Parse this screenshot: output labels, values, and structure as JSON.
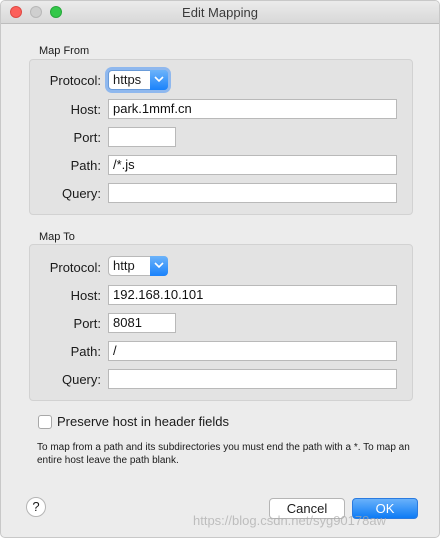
{
  "window": {
    "title": "Edit Mapping"
  },
  "map_from": {
    "section_label": "Map From",
    "protocol_label": "Protocol:",
    "protocol_value": "https",
    "host_label": "Host:",
    "host_value": "park.1mmf.cn",
    "port_label": "Port:",
    "port_value": "",
    "path_label": "Path:",
    "path_value": "/*.js",
    "query_label": "Query:",
    "query_value": ""
  },
  "map_to": {
    "section_label": "Map To",
    "protocol_label": "Protocol:",
    "protocol_value": "http",
    "host_label": "Host:",
    "host_value": "192.168.10.101",
    "port_label": "Port:",
    "port_value": "8081",
    "path_label": "Path:",
    "path_value": "/",
    "query_label": "Query:",
    "query_value": ""
  },
  "preserve_host": {
    "label": "Preserve host in header fields",
    "checked": false
  },
  "help_text": "To map from a path and its subdirectories you must end the path with a *. To map an entire host leave the path blank.",
  "buttons": {
    "help": "?",
    "cancel": "Cancel",
    "ok": "OK"
  },
  "watermark": "https://blog.csdn.net/syg90178aw",
  "colors": {
    "accent": "#1a82fb",
    "focus_ring": "#8fb8ee"
  }
}
